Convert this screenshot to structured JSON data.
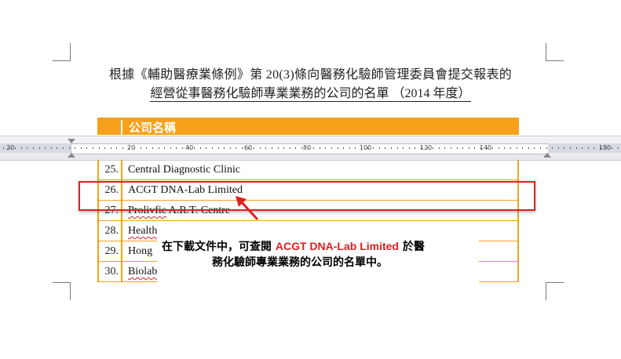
{
  "document": {
    "title_line1": "根據《輔助醫療業條例》第 20(3)條向醫務化驗師管理委員會提交報表的",
    "title_line2": "經營從事醫務化驗師專業業務的公司的名單 （2014 年度）",
    "column_header": "公司名稱"
  },
  "ruler": {
    "labels": [
      "20",
      "20",
      "40",
      "60",
      "80",
      "100",
      "120",
      "140",
      "180"
    ]
  },
  "table": {
    "rows": [
      {
        "num": "25.",
        "name": "Central Diagnostic Clinic"
      },
      {
        "num": "26.",
        "name": "ACGT DNA-Lab Limited"
      },
      {
        "num": "27.",
        "name_squig": "Prolivfic",
        "name_rest": " A.R.T. Centre"
      },
      {
        "num": "28.",
        "name_squig": "Health",
        "name_rest": ""
      },
      {
        "num": "29.",
        "name_squig": "",
        "name_rest": "Hong"
      },
      {
        "num": "30.",
        "name_squig": "Biolab",
        "name_rest": ""
      }
    ]
  },
  "callout": {
    "prefix": "在下載文件中，可查閱",
    "highlight": "ACGT DNA-Lab Limited",
    "suffix": "於醫",
    "line2": "務化驗師專業業務的公司的名單中。"
  },
  "colors": {
    "accent_orange": "#f7a11a",
    "highlight_red": "#e02020"
  }
}
